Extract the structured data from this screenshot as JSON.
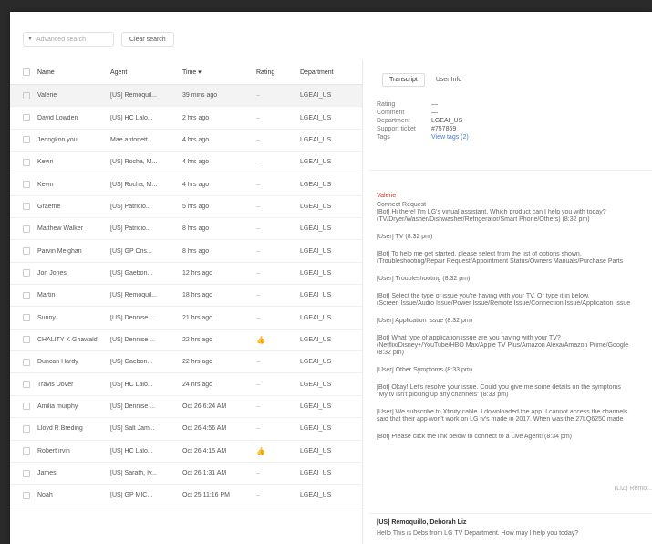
{
  "toolbar": {
    "search_placeholder": "Advanced search",
    "clear_label": "Clear search"
  },
  "table": {
    "headers": {
      "name": "Name",
      "agent": "Agent",
      "time": "Time ▾",
      "rating": "Rating",
      "dept": "Department"
    },
    "rows": [
      {
        "name": "Valerie",
        "agent": "[US] Remoquil...",
        "time": "39 mins ago",
        "rating": "–",
        "dept": "LGEAI_US",
        "thumb": false
      },
      {
        "name": "David Lowden",
        "agent": "[US] HC Lalo...",
        "time": "2 hrs ago",
        "rating": "–",
        "dept": "LGEAI_US",
        "thumb": false
      },
      {
        "name": "Jeongkon you",
        "agent": "Mae antonett...",
        "time": "4 hrs ago",
        "rating": "–",
        "dept": "LGEAI_US",
        "thumb": false
      },
      {
        "name": "Kevin",
        "agent": "[US] Rocha, M...",
        "time": "4 hrs ago",
        "rating": "–",
        "dept": "LGEAI_US",
        "thumb": false
      },
      {
        "name": "Kevin",
        "agent": "[US] Rocha, M...",
        "time": "4 hrs ago",
        "rating": "–",
        "dept": "LGEAI_US",
        "thumb": false
      },
      {
        "name": "Graeme",
        "agent": "[US] Patricio...",
        "time": "5 hrs ago",
        "rating": "–",
        "dept": "LGEAI_US",
        "thumb": false
      },
      {
        "name": "Matthew Walker",
        "agent": "[US] Patricio...",
        "time": "8 hrs ago",
        "rating": "–",
        "dept": "LGEAI_US",
        "thumb": false
      },
      {
        "name": "Parvin Meighan",
        "agent": "[US] GP Cris...",
        "time": "8 hrs ago",
        "rating": "–",
        "dept": "LGEAI_US",
        "thumb": false
      },
      {
        "name": "Jon Jones",
        "agent": "[US] Gaebon...",
        "time": "12 hrs ago",
        "rating": "–",
        "dept": "LGEAI_US",
        "thumb": false
      },
      {
        "name": "Martin",
        "agent": "[US] Remoquil...",
        "time": "18 hrs ago",
        "rating": "–",
        "dept": "LGEAI_US",
        "thumb": false
      },
      {
        "name": "Sunny",
        "agent": "[US] Dennise ...",
        "time": "21 hrs ago",
        "rating": "–",
        "dept": "LGEAI_US",
        "thumb": false
      },
      {
        "name": "CHALITY K Ghawaldi",
        "agent": "[US] Dennise ...",
        "time": "22 hrs ago",
        "rating": "",
        "dept": "LGEAI_US",
        "thumb": true
      },
      {
        "name": "Duncan Hardy",
        "agent": "[US] Gaebon...",
        "time": "22 hrs ago",
        "rating": "–",
        "dept": "LGEAI_US",
        "thumb": false
      },
      {
        "name": "Travis Dover",
        "agent": "[US] HC Lalo...",
        "time": "24 hrs ago",
        "rating": "–",
        "dept": "LGEAI_US",
        "thumb": false
      },
      {
        "name": "Amilia murphy",
        "agent": "[US] Dennise ...",
        "time": "Oct 26 6:24 AM",
        "rating": "–",
        "dept": "LGEAI_US",
        "thumb": false
      },
      {
        "name": "Lloyd R Breding",
        "agent": "[US] Salt Jam...",
        "time": "Oct 26 4:56 AM",
        "rating": "–",
        "dept": "LGEAI_US",
        "thumb": false
      },
      {
        "name": "Robert irvin",
        "agent": "[US] HC Lalo...",
        "time": "Oct 26 4:15 AM",
        "rating": "",
        "dept": "LGEAI_US",
        "thumb": true
      },
      {
        "name": "James",
        "agent": "[US] Sarath, Iy...",
        "time": "Oct 26 1:31 AM",
        "rating": "–",
        "dept": "LGEAI_US",
        "thumb": false
      },
      {
        "name": "Noah",
        "agent": "[US] GP MIC...",
        "time": "Oct 25 11:16 PM",
        "rating": "–",
        "dept": "LGEAI_US",
        "thumb": false
      }
    ]
  },
  "panel": {
    "tabs": [
      "Transcript",
      "User Info"
    ],
    "info": [
      {
        "k": "Rating",
        "v": "—",
        "link": false
      },
      {
        "k": "Comment",
        "v": "—",
        "link": false
      },
      {
        "k": "Department",
        "v": "LGEAI_US",
        "link": false
      },
      {
        "k": "Support ticket",
        "v": "#757869",
        "link": false
      },
      {
        "k": "Tags",
        "v": "View tags (2)",
        "link": true
      }
    ],
    "transcript_user": "Valerie",
    "messages": [
      {
        "text": "Connect Request",
        "tight": true
      },
      {
        "text": "[Bot] Hi there! I'm LG's virtual assistant. Which product can I help you with today?",
        "tight": true
      },
      {
        "text": "(TV/Dryer/Washer/Dishwasher/Refrigerator/Smart Phone/Others) (8:32 pm)",
        "tight": false
      },
      {
        "text": "[User] TV (8:32 pm)",
        "tight": false
      },
      {
        "text": "[Bot] To help me get started, please select from the list of options shown.",
        "tight": true
      },
      {
        "text": "(Troubleshooting/Repair Request/Appointment Status/Owners Manuals/Purchase Parts",
        "tight": false
      },
      {
        "text": "[User] Troubleshooting (8:32 pm)",
        "tight": false
      },
      {
        "text": "[Bot] Select the type of issue you're having with your TV. Or type it in below.",
        "tight": true
      },
      {
        "text": "(Screen Issue/Audio Issue/Power Issue/Remote Issue/Connection Issue/Application Issue",
        "tight": false
      },
      {
        "text": "[User] Application Issue (8:32 pm)",
        "tight": false
      },
      {
        "text": "[Bot] What type of application issue are you having with your TV?",
        "tight": true
      },
      {
        "text": "(Netflix/Disney+/YouTube/HBO Max/Apple TV Plus/Amazon Alexa/Amazon Prime/Google",
        "tight": true
      },
      {
        "text": "(8:32 pm)",
        "tight": false
      },
      {
        "text": "[User] Other Symptoms (8:33 pm)",
        "tight": false
      },
      {
        "text": "[Bot] Okay! Let's resolve your issue. Could you give me some details on the symptoms",
        "tight": true
      },
      {
        "text": "\"My tv isn't picking up any channels\" (8:33 pm)",
        "tight": false
      },
      {
        "text": "[User] We subscribe to Xfinity cable. I downloaded the app. I cannot access the channels",
        "tight": true
      },
      {
        "text": "said that their app won't work on LG tv's made in 2017. When was the 27LQ6250 made",
        "tight": false
      },
      {
        "text": "[Bot] Please click the link below to connect to a Live Agent! (8:34 pm)",
        "tight": false
      }
    ],
    "right_note": "(LIZ) Remo...",
    "agent_name": "[US] Remoquillo, Deborah Liz",
    "agent_msg": "Hello This is Debs from LG TV Department. How may I help you today?"
  }
}
